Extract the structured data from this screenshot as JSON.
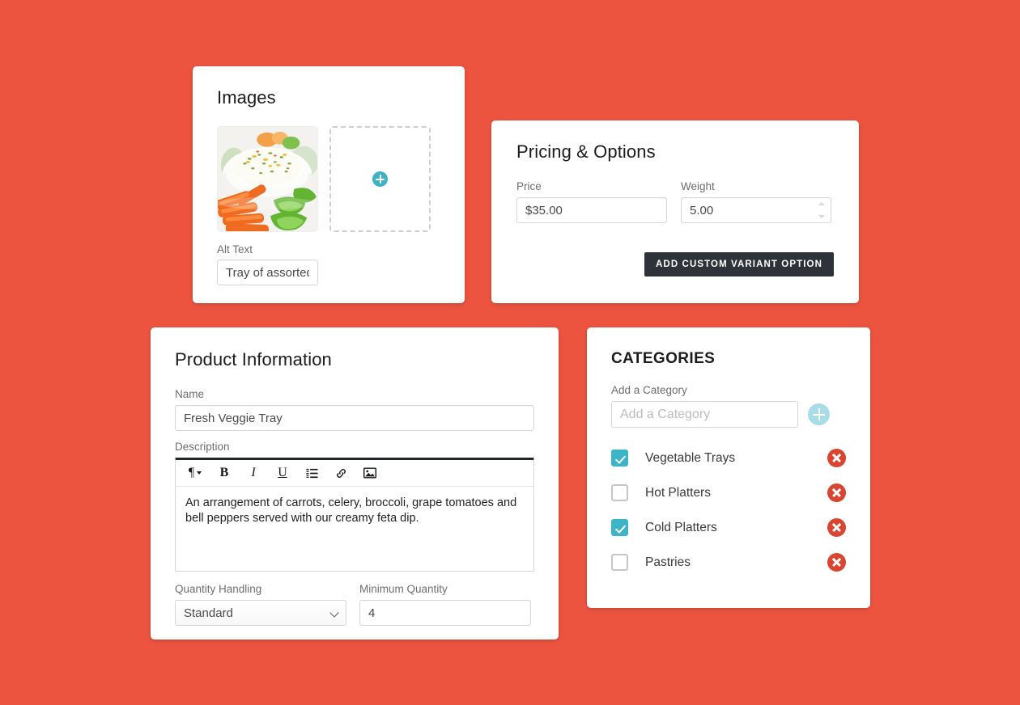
{
  "theme": {
    "background": "#ec5440",
    "accent_teal": "#3cb6c6",
    "accent_teal_pale": "#a8dce6",
    "danger_red": "#d94530",
    "button_dark": "#2e3339"
  },
  "images_card": {
    "title": "Images",
    "thumbnail_alt": "Tray of assorted vegetables with dip",
    "add_image_icon": "plus-circle-icon",
    "alt_text": {
      "label": "Alt Text",
      "value": "Tray of assorted"
    }
  },
  "pricing_card": {
    "title": "Pricing & Options",
    "price": {
      "label": "Price",
      "value": "$35.00"
    },
    "weight": {
      "label": "Weight",
      "value": "5.00"
    },
    "variant_button": "ADD CUSTOM VARIANT OPTION"
  },
  "product_card": {
    "title": "Product Information",
    "name": {
      "label": "Name",
      "value": "Fresh Veggie Tray"
    },
    "description": {
      "label": "Description",
      "value": "An arrangement of carrots, celery, broccoli, grape tomatoes and bell peppers served with our creamy feta dip.",
      "toolbar": [
        {
          "name": "paragraph-format-dropdown",
          "glyph": "¶"
        },
        {
          "name": "bold-button",
          "glyph": "B"
        },
        {
          "name": "italic-button",
          "glyph": "I"
        },
        {
          "name": "underline-button",
          "glyph": "U"
        },
        {
          "name": "ordered-list-button",
          "glyph": "list"
        },
        {
          "name": "link-button",
          "glyph": "link"
        },
        {
          "name": "insert-image-button",
          "glyph": "image"
        }
      ]
    },
    "quantity_handling": {
      "label": "Quantity Handling",
      "value": "Standard",
      "options": [
        "Standard"
      ]
    },
    "minimum_quantity": {
      "label": "Minimum Quantity",
      "value": "4"
    }
  },
  "categories_card": {
    "title": "CATEGORIES",
    "add_category": {
      "label": "Add a Category",
      "value": "",
      "placeholder": "Add a Category",
      "add_icon": "plus-circle-icon"
    },
    "items": [
      {
        "label": "Vegetable Trays",
        "checked": true
      },
      {
        "label": "Hot Platters",
        "checked": false
      },
      {
        "label": "Cold Platters",
        "checked": true
      },
      {
        "label": "Pastries",
        "checked": false
      }
    ]
  }
}
